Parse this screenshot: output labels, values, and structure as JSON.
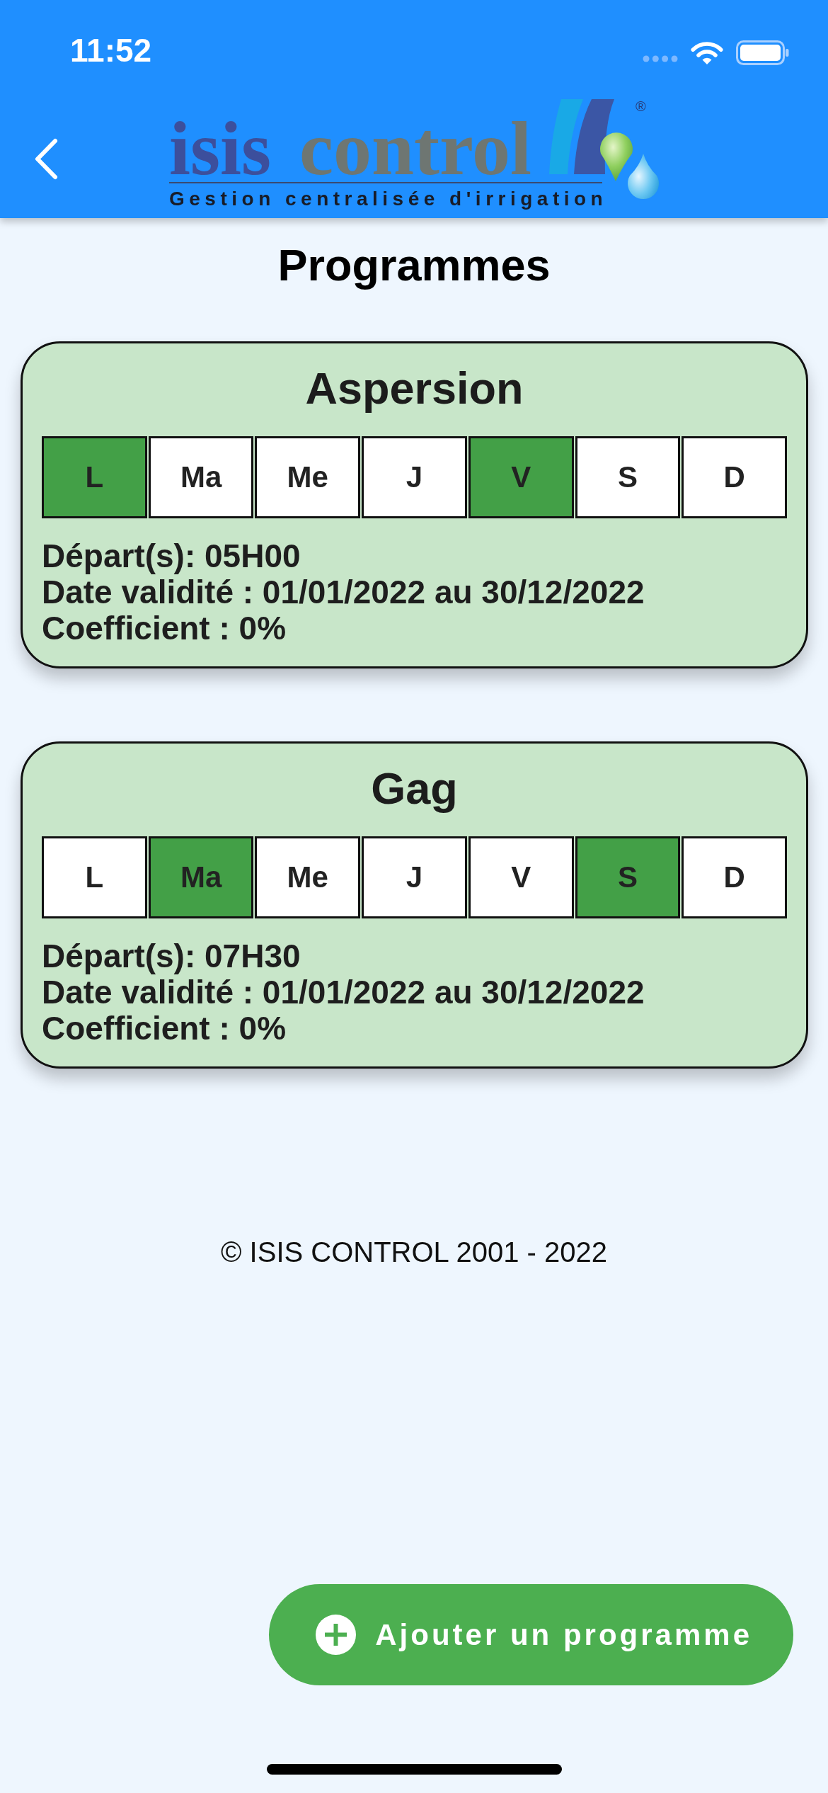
{
  "status_bar": {
    "time": "11:52"
  },
  "header": {
    "logo": {
      "wordmark": [
        "isis",
        "control"
      ],
      "registered_mark": "®",
      "tagline": "Gestion centralisée d'irrigation"
    }
  },
  "title": "Programmes",
  "programs": [
    {
      "name": "Aspersion",
      "days": [
        {
          "label": "L",
          "selected": true
        },
        {
          "label": "Ma",
          "selected": false
        },
        {
          "label": "Me",
          "selected": false
        },
        {
          "label": "J",
          "selected": false
        },
        {
          "label": "V",
          "selected": true
        },
        {
          "label": "S",
          "selected": false
        },
        {
          "label": "D",
          "selected": false
        }
      ],
      "details": [
        "Départ(s): 05H00",
        "Date validité : 01/01/2022 au 30/12/2022",
        "Coefficient : 0%"
      ]
    },
    {
      "name": "Gag",
      "days": [
        {
          "label": "L",
          "selected": false
        },
        {
          "label": "Ma",
          "selected": true
        },
        {
          "label": "Me",
          "selected": false
        },
        {
          "label": "J",
          "selected": false
        },
        {
          "label": "V",
          "selected": false
        },
        {
          "label": "S",
          "selected": true
        },
        {
          "label": "D",
          "selected": false
        }
      ],
      "details": [
        "Départ(s): 07H30",
        "Date validité : 01/01/2022 au 30/12/2022",
        "Coefficient : 0%"
      ]
    }
  ],
  "footer": {
    "copyright": "© ISIS CONTROL 2001 - 2022"
  },
  "add_button": {
    "label": "Ajouter un programme"
  }
}
